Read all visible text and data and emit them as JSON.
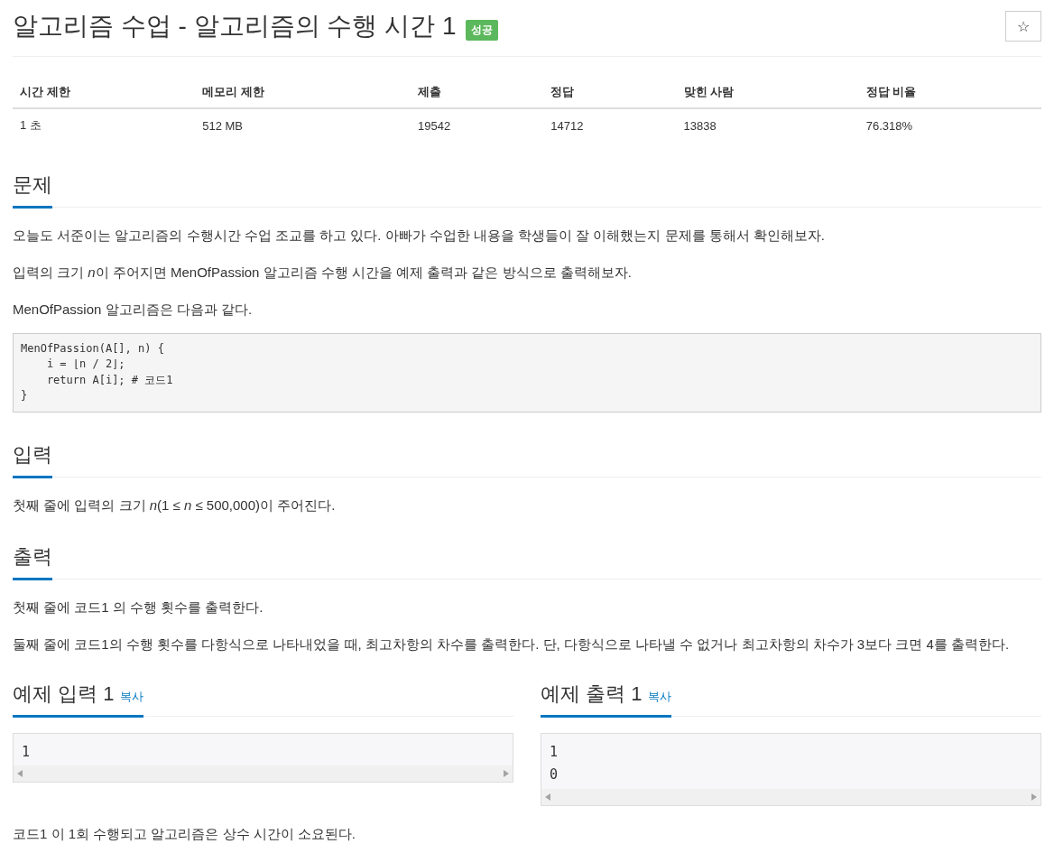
{
  "title": "알고리즘 수업 - 알고리즘의 수행 시간 1",
  "result_badge": "성공",
  "star_button": "☆",
  "stats": {
    "columns": [
      "시간 제한",
      "메모리 제한",
      "제출",
      "정답",
      "맞힌 사람",
      "정답 비율"
    ],
    "rows": [
      [
        "1 초",
        "512 MB",
        "19542",
        "14712",
        "13838",
        "76.318%"
      ]
    ]
  },
  "sections": [
    {
      "heading": "문제",
      "blocks": [
        {
          "kind": "paragraph",
          "text": "오늘도 서준이는 알고리즘의 수행시간 수업 조교를 하고 있다. 아빠가 수업한 내용을 학생들이 잘 이해했는지 문제를 통해서 확인해보자."
        },
        {
          "kind": "runs",
          "parts": [
            {
              "text": "입력의 크기 ",
              "italic": false
            },
            {
              "text": "n",
              "italic": true
            },
            {
              "text": "이 주어지면 MenOfPassion 알고리즘 수행 시간을 예제 출력과 같은 방식으로 출력해보자.",
              "italic": false
            }
          ]
        },
        {
          "kind": "paragraph",
          "text": "MenOfPassion 알고리즘은 다음과 같다."
        },
        {
          "kind": "code",
          "text": "MenOfPassion(A[], n) {\n    i = ⌊n / 2⌋;\n    return A[i]; # 코드1\n}"
        }
      ]
    },
    {
      "heading": "입력",
      "blocks": [
        {
          "kind": "paragraph",
          "text": "첫째 줄에 입력의 크기 *n*(1 ≤ *n* ≤ 500,000)이 주어진다."
        }
      ]
    },
    {
      "heading": "출력",
      "blocks": [
        {
          "kind": "paragraph",
          "text": "첫째 줄에 코드1 의 수행 횟수를 출력한다."
        },
        {
          "kind": "paragraph",
          "text": "둘째 줄에 코드1의 수행 횟수를 다항식으로 나타내었을 때, 최고차항의 차수를 출력한다. 단, 다항식으로 나타낼 수 없거나 최고차항의 차수가 3보다 크면 4를 출력한다."
        }
      ]
    }
  ],
  "samples": [
    {
      "heading": "예제 입력 1",
      "copy_link": "복사",
      "content": "1"
    },
    {
      "heading": "예제 출력 1",
      "copy_link": "복사",
      "content": "1\n0"
    }
  ],
  "note": "코드1 이 1회 수행되고 알고리즘은 상수 시간이 소요된다."
}
